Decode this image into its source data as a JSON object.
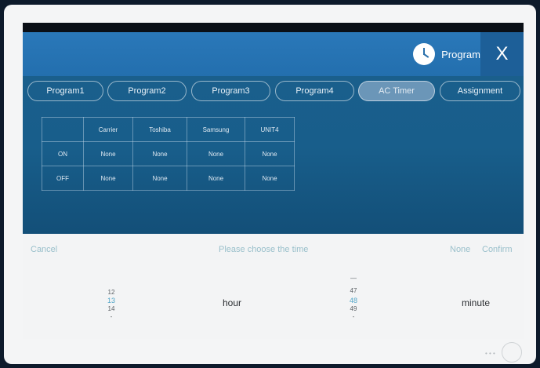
{
  "header": {
    "title": "Program",
    "close": "X"
  },
  "tabs": [
    "Program1",
    "Program2",
    "Program3",
    "Program4",
    "AC Timer",
    "Assignment"
  ],
  "table": {
    "columns": [
      "",
      "Carrier",
      "Toshiba",
      "Samsung",
      "UNIT4"
    ],
    "rows": [
      {
        "label": "ON",
        "cells": [
          "None",
          "None",
          "None",
          "None"
        ]
      },
      {
        "label": "OFF",
        "cells": [
          "None",
          "None",
          "None",
          "None"
        ]
      }
    ]
  },
  "picker": {
    "cancel": "Cancel",
    "title": "Please choose the time",
    "none": "None",
    "confirm": "Confirm",
    "hour_values": [
      "12",
      "13",
      "14",
      "-"
    ],
    "hour_label": "hour",
    "minute_values": [
      "—",
      "47",
      "48",
      "49",
      "-"
    ],
    "minute_label": "minute"
  },
  "colors": {
    "accent": "#2a78b9",
    "selected": "#53a6c8"
  }
}
